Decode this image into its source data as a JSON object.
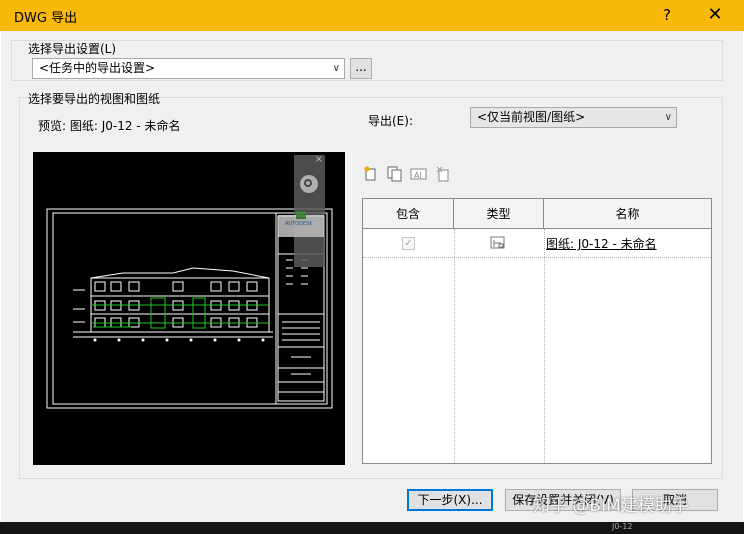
{
  "window": {
    "title": "DWG 导出",
    "help_glyph": "?",
    "close_glyph": "✕"
  },
  "export_settings": {
    "group_label": "选择导出设置(L)",
    "selected": "<任务中的导出设置>",
    "browse_label": "..."
  },
  "views": {
    "group_label": "选择要导出的视图和图纸",
    "preview_label": "预览: 图纸: J0-12 - 未命名",
    "export_label": "导出(E):",
    "export_selected": "<仅当前视图/图纸>"
  },
  "preview_overlay": {
    "close_glyph": "×",
    "logo_text": "AUTODESK"
  },
  "table": {
    "columns": [
      "包含",
      "类型",
      "名称"
    ],
    "rows": [
      {
        "included": true,
        "type_icon": "sheet-icon",
        "name": "图纸: J0-12 - 未命名"
      }
    ]
  },
  "buttons": {
    "next": "下一步(X)...",
    "save_close": "保存设置并关闭(V)",
    "cancel": "取消"
  },
  "watermark": "知乎 @BIM建模助手",
  "background_label": "J0-12"
}
